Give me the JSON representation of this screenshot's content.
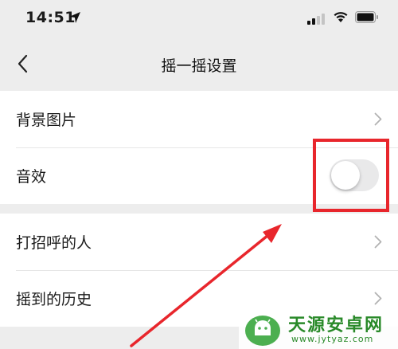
{
  "status_bar": {
    "time": "14:51"
  },
  "nav": {
    "title": "摇一摇设置"
  },
  "settings": {
    "group1": [
      {
        "label": "背景图片",
        "control": "chevron"
      },
      {
        "label": "音效",
        "control": "toggle",
        "toggle_on": false
      }
    ],
    "group2": [
      {
        "label": "打招呼的人",
        "control": "chevron"
      },
      {
        "label": "摇到的历史",
        "control": "chevron"
      }
    ]
  },
  "annotation": {
    "box_color": "#e8262c",
    "arrow_color": "#e8262c"
  },
  "watermark": {
    "title": "天源安卓网",
    "url": "www.jytyaz.com"
  },
  "icons": [
    "location-arrow-icon",
    "signal-icon",
    "wifi-icon",
    "battery-icon",
    "back-chevron-icon",
    "chevron-right-icon",
    "android-logo-icon"
  ]
}
